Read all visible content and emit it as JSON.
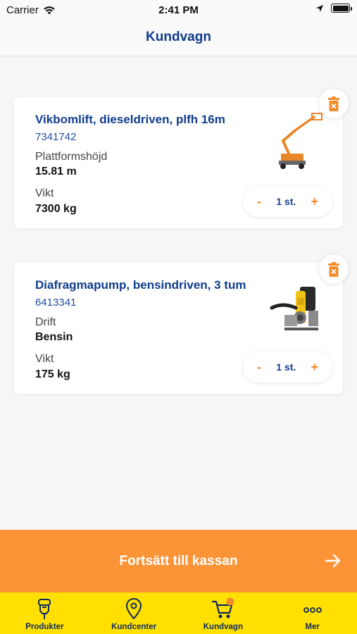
{
  "status_bar": {
    "carrier": "Carrier",
    "time": "2:41 PM"
  },
  "header": {
    "title": "Kundvagn"
  },
  "cart": {
    "items": [
      {
        "name": "Vikbomlift, dieseldriven, plfh 16m",
        "sku": "7341742",
        "attr1_label": "Plattformshöjd",
        "attr1_value": "15.81 m",
        "attr2_label": "Vikt",
        "attr2_value": "7300 kg",
        "quantity": "1 st."
      },
      {
        "name": "Diafragmapump, bensindriven, 3 tum",
        "sku": "6413341",
        "attr1_label": "Drift",
        "attr1_value": "Bensin",
        "attr2_label": "Vikt",
        "attr2_value": "175 kg",
        "quantity": "1 st."
      }
    ],
    "stepper": {
      "minus": "-",
      "plus": "+"
    }
  },
  "checkout": {
    "label": "Fortsätt till kassan"
  },
  "tabs": [
    {
      "label": "Produkter",
      "icon": "jackhammer-icon"
    },
    {
      "label": "Kundcenter",
      "icon": "location-pin-icon"
    },
    {
      "label": "Kundvagn",
      "icon": "cart-icon"
    },
    {
      "label": "Mer",
      "icon": "more-dots-icon"
    }
  ],
  "colors": {
    "brand_blue": "#0f3c8c",
    "accent_orange": "#fb9437",
    "tab_yellow": "#ffe000",
    "badge_orange": "#f28b2a"
  }
}
